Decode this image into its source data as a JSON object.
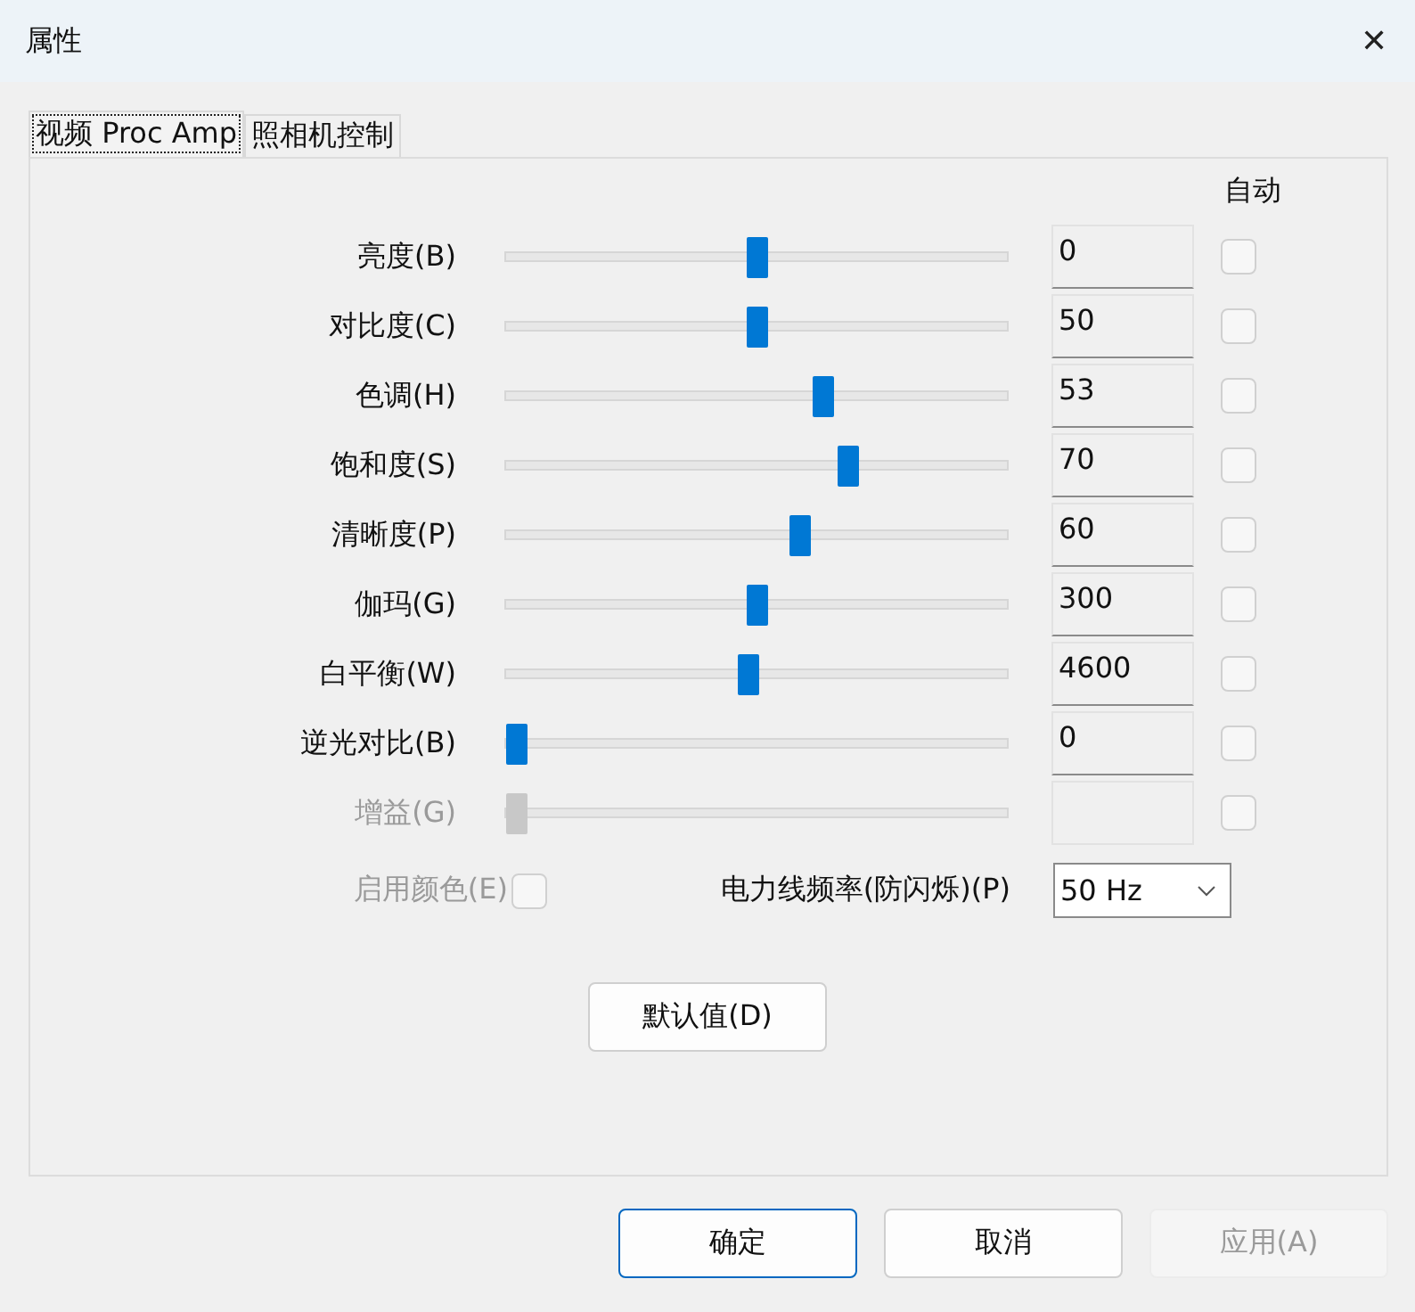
{
  "window": {
    "title": "属性",
    "close": "✕"
  },
  "tabs": [
    {
      "label": "视频 Proc Amp",
      "selected": true
    },
    {
      "label": "照相机控制",
      "selected": false
    }
  ],
  "auto_header": "自动",
  "controls": [
    {
      "label": "亮度(B)",
      "level": 0.5,
      "value": "0",
      "auto": false,
      "disabled": false
    },
    {
      "label": "对比度(C)",
      "level": 0.5,
      "value": "50",
      "auto": false,
      "disabled": false
    },
    {
      "label": "色调(H)",
      "level": 0.64,
      "value": "53",
      "auto": false,
      "disabled": false
    },
    {
      "label": "饱和度(S)",
      "level": 0.69,
      "value": "70",
      "auto": false,
      "disabled": false
    },
    {
      "label": "清晰度(P)",
      "level": 0.59,
      "value": "60",
      "auto": false,
      "disabled": false
    },
    {
      "label": "伽玛(G)",
      "level": 0.5,
      "value": "300",
      "auto": false,
      "disabled": false
    },
    {
      "label": "白平衡(W)",
      "level": 0.485,
      "value": "4600",
      "auto": false,
      "disabled": false
    },
    {
      "label": "逆光对比(B)",
      "level": 0,
      "value": "0",
      "auto": false,
      "disabled": false
    },
    {
      "label": "增益(G)",
      "level": 0,
      "auto": false,
      "disabled": true
    }
  ],
  "color_enable": {
    "label": "启用颜色(E)",
    "checked": false,
    "disabled": true
  },
  "powerline": {
    "label": "电力线频率(防闪烁)(P)",
    "value": "50 Hz"
  },
  "default_button": "默认值(D)",
  "buttons": [
    {
      "label": "确定",
      "kind": "primary"
    },
    {
      "label": "取消",
      "kind": "normal"
    },
    {
      "label": "应用(A)",
      "kind": "disabled"
    }
  ]
}
